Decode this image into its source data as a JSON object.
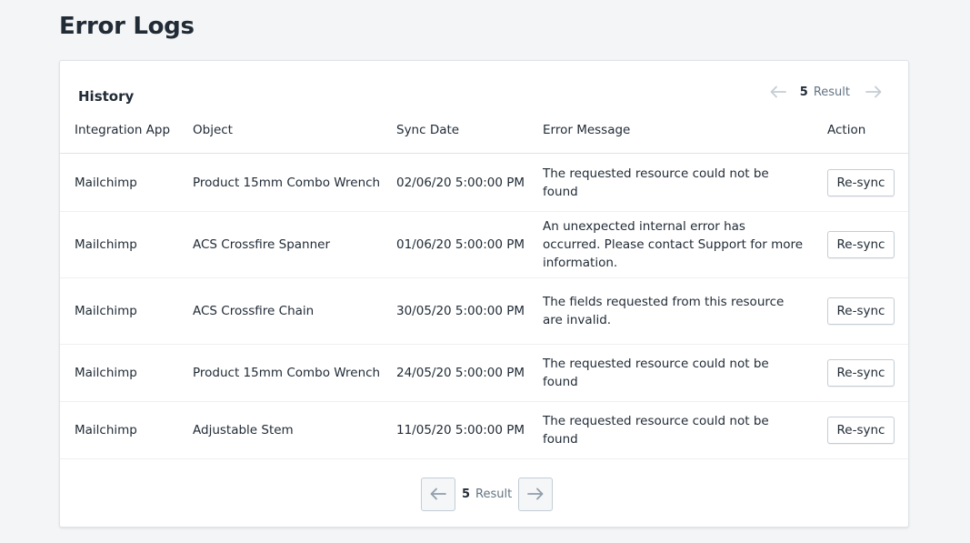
{
  "page": {
    "title": "Error Logs"
  },
  "card": {
    "title": "History",
    "pager": {
      "count": "5",
      "result_label": "Result"
    }
  },
  "columns": {
    "app": "Integration App",
    "object": "Object",
    "date": "Sync Date",
    "message": "Error Message",
    "action": "Action"
  },
  "rows": [
    {
      "app": "Mailchimp",
      "object": "Product 15mm Combo Wrench",
      "date": "02/06/20 5:00:00 PM",
      "message": "The requested resource could not be found",
      "action": "Re-sync"
    },
    {
      "app": "Mailchimp",
      "object": "ACS Crossfire Spanner",
      "date": "01/06/20 5:00:00 PM",
      "message": "An unexpected internal error has occurred. Please contact Support for more information.",
      "action": "Re-sync"
    },
    {
      "app": "Mailchimp",
      "object": "ACS Crossfire Chain",
      "date": "30/05/20 5:00:00 PM",
      "message": "The fields requested from this resource are invalid.",
      "action": "Re-sync"
    },
    {
      "app": "Mailchimp",
      "object": "Product 15mm Combo Wrench",
      "date": "24/05/20 5:00:00 PM",
      "message": "The requested resource could not be found",
      "action": "Re-sync"
    },
    {
      "app": "Mailchimp",
      "object": "Adjustable Stem",
      "date": "11/05/20 5:00:00 PM",
      "message": "The requested resource could not be found",
      "action": "Re-sync"
    }
  ],
  "footer_pager": {
    "count": "5",
    "result_label": "Result"
  },
  "icons": {
    "prev": "arrow-left-icon",
    "next": "arrow-right-icon"
  },
  "colors": {
    "background": "#f4f5f6",
    "card": "#ffffff",
    "text": "#212b36",
    "muted": "#637381",
    "border": "#c4cdd5"
  }
}
